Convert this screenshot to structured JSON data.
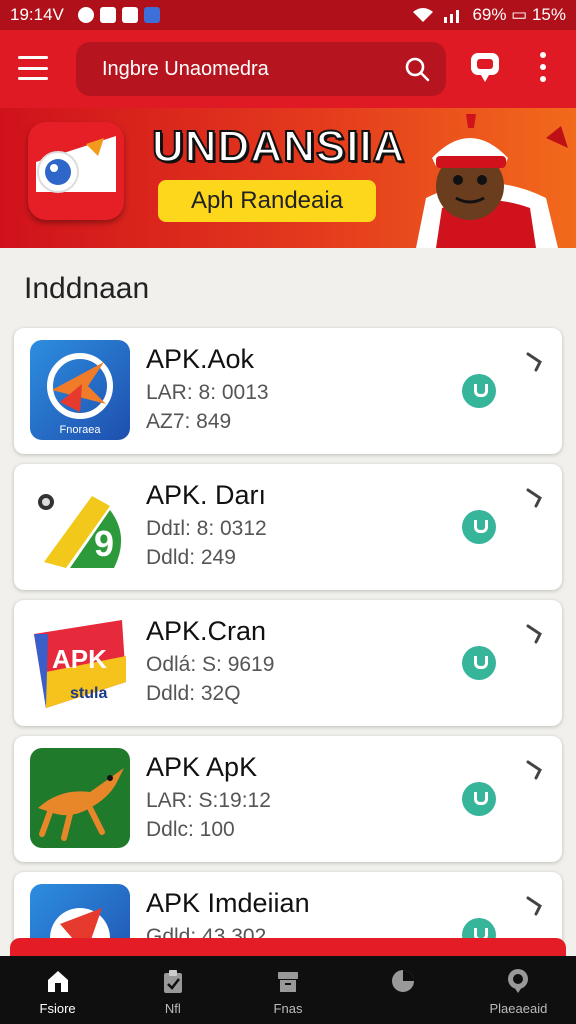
{
  "status": {
    "time": "19:14V",
    "battery": "69% ▭ 15%"
  },
  "search": {
    "placeholder": "Ingbre Unaomedra"
  },
  "banner": {
    "title": "UNDANSIIA",
    "button": "Aph Randeaia"
  },
  "section_title": "Inddnaan",
  "apps": [
    {
      "name": "APK.Aok",
      "line1": "LAR: 8: 0013",
      "line2": "AZ7: 849",
      "icon_label": "Fnoraea"
    },
    {
      "name": "APK. Darı",
      "line1": "Ddɪl: 8: 0312",
      "line2": "Ddld: 249",
      "icon_label": ""
    },
    {
      "name": "APK.Cran",
      "line1": "Odlá: S: 9619",
      "line2": "Ddld: 32Q",
      "icon_label": "APK"
    },
    {
      "name": "APK ApK",
      "line1": "LAR: S:19:12",
      "line2": "Ddlc: 100",
      "icon_label": ""
    },
    {
      "name": "APK  Imdeiian",
      "line1": "Gdld: 43 302",
      "line2": "",
      "icon_label": ""
    }
  ],
  "nav": [
    {
      "label": "Fsiore",
      "icon": "home-icon"
    },
    {
      "label": "Nfl",
      "icon": "clipboard-icon"
    },
    {
      "label": "Fnas",
      "icon": "archive-icon"
    },
    {
      "label": "",
      "icon": "chart-icon"
    },
    {
      "label": "Plaeaeaid",
      "icon": "chat-icon"
    }
  ]
}
